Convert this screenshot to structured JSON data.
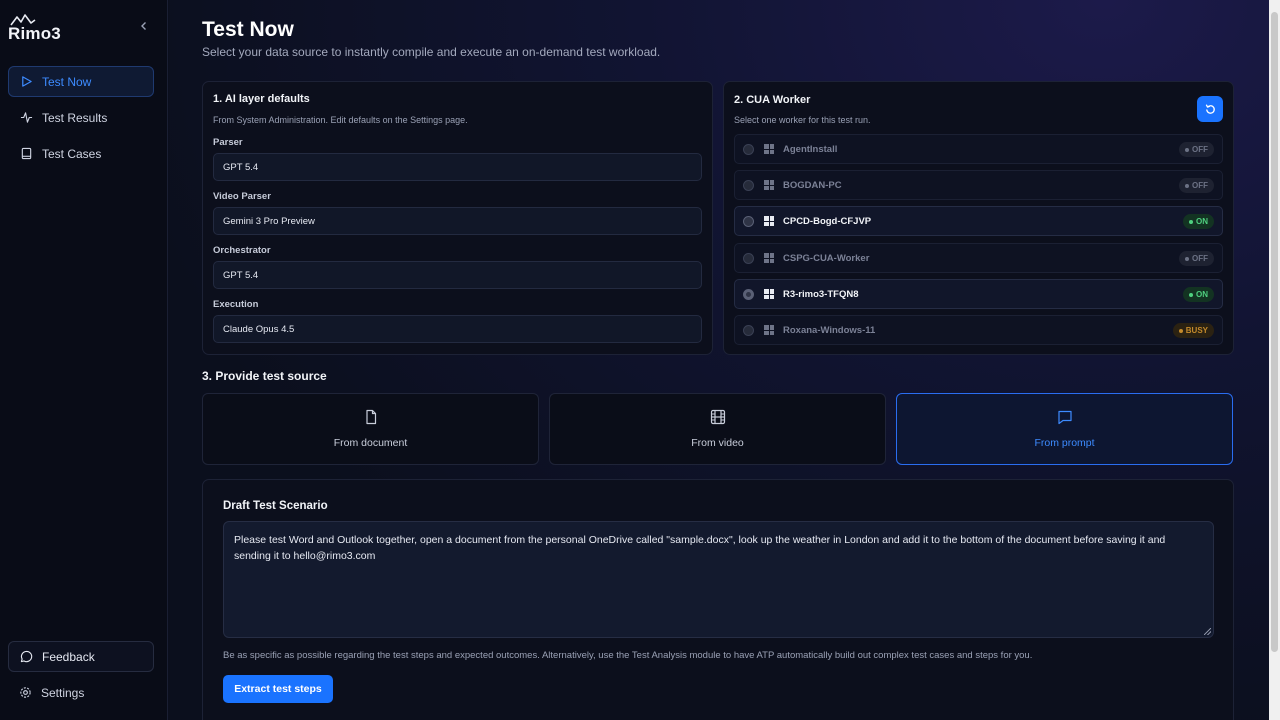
{
  "app": {
    "logo_text": "Rimo3"
  },
  "sidebar": {
    "items": [
      {
        "label": "Test Now",
        "icon": "play-icon",
        "active": true
      },
      {
        "label": "Test Results",
        "icon": "activity-icon"
      },
      {
        "label": "Test Cases",
        "icon": "book-icon"
      }
    ],
    "feedback_label": "Feedback",
    "settings_label": "Settings"
  },
  "header": {
    "title": "Test Now",
    "subtitle": "Select your data source to instantly compile and execute an on-demand test workload."
  },
  "ai_defaults": {
    "title": "1. AI layer defaults",
    "subtitle": "From System Administration. Edit defaults on the Settings page.",
    "fields": [
      {
        "label": "Parser",
        "value": "GPT 5.4"
      },
      {
        "label": "Video Parser",
        "value": "Gemini 3 Pro Preview"
      },
      {
        "label": "Orchestrator",
        "value": "GPT 5.4"
      },
      {
        "label": "Execution",
        "value": "Claude Opus 4.5"
      }
    ]
  },
  "cua_worker": {
    "title": "2. CUA Worker",
    "subtitle": "Select one worker for this test run.",
    "workers": [
      {
        "name": "AgentInstall",
        "status": "OFF",
        "selected": false
      },
      {
        "name": "BOGDAN-PC",
        "status": "OFF",
        "selected": false
      },
      {
        "name": "CPCD-Bogd-CFJVP",
        "status": "ON",
        "selected": false
      },
      {
        "name": "CSPG-CUA-Worker",
        "status": "OFF",
        "selected": false
      },
      {
        "name": "R3-rimo3-TFQN8",
        "status": "ON",
        "selected": true
      },
      {
        "name": "Roxana-Windows-11",
        "status": "BUSY",
        "selected": false
      }
    ]
  },
  "test_source": {
    "title": "3. Provide test source",
    "options": [
      {
        "label": "From document",
        "icon": "document-icon",
        "selected": false
      },
      {
        "label": "From video",
        "icon": "film-icon",
        "selected": false
      },
      {
        "label": "From prompt",
        "icon": "chat-icon",
        "selected": true
      }
    ]
  },
  "draft": {
    "title": "Draft Test Scenario",
    "text": "Please test Word and Outlook together, open a document from the personal OneDrive called \"sample.docx\", look up the weather in London and add it to the bottom of the document before saving it and sending it to hello@rimo3.com",
    "hint": "Be as specific as possible regarding the test steps and expected outcomes. Alternatively, use the Test Analysis module to have ATP automatically build out complex test cases and steps for you.",
    "button_label": "Extract test steps"
  },
  "colors": {
    "accent": "#1a73ff",
    "status_on": "#4fd07f",
    "status_busy": "#c48a2b",
    "status_off": "#6c7285"
  }
}
